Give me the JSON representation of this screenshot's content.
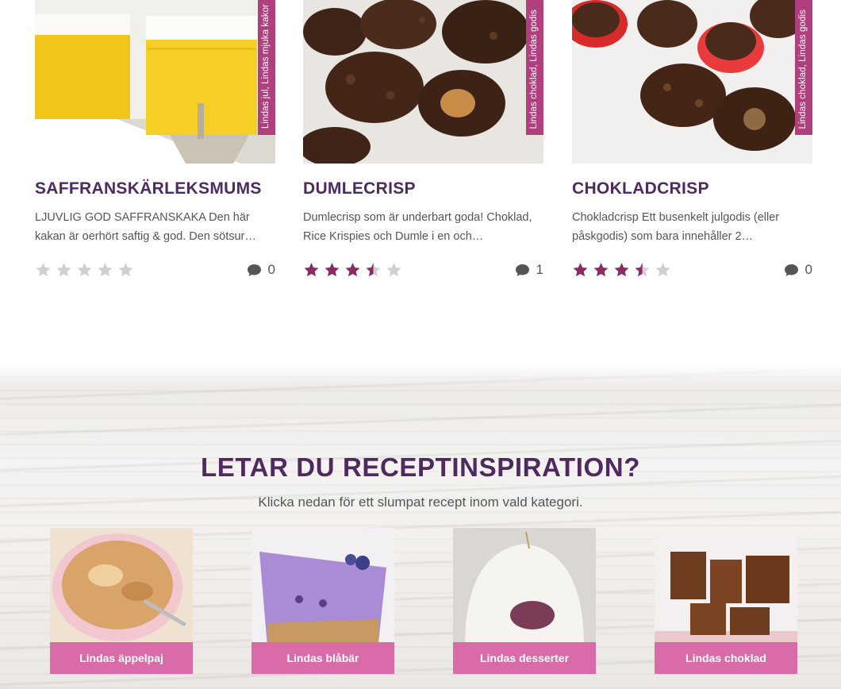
{
  "recipes": [
    {
      "title": "SAFFRANSKÄRLEKSMUMS",
      "categories": "Lindas jul, Lindas mjuka kakor",
      "excerpt": "LJUVLIG GOD SAFFRANSKAKA Den här kakan är oerhört saftig & god. Den sötsur…",
      "rating": 0,
      "comments": "0"
    },
    {
      "title": "DUMLECRISP",
      "categories": "Lindas choklad, Lindas godis",
      "excerpt": "Dumlecrisp som är underbart goda! Choklad, Rice Krispies och Dumle i en och…",
      "rating": 3.5,
      "comments": "1"
    },
    {
      "title": "CHOKLADCRISP",
      "categories": "Lindas choklad, Lindas godis",
      "excerpt": "Chokladcrisp Ett busenkelt julgodis (eller påskgodis) som bara innehåller 2…",
      "rating": 3.5,
      "comments": "0"
    }
  ],
  "inspiration": {
    "title": "LETAR DU RECEPTINSPIRATION?",
    "subtitle": "Klicka nedan för ett slumpat recept inom vald kategori.",
    "categories": [
      {
        "label": "Lindas äppelpaj"
      },
      {
        "label": "Lindas blåbär"
      },
      {
        "label": "Lindas desserter"
      },
      {
        "label": "Lindas choklad"
      }
    ]
  },
  "colors": {
    "brand_purple": "#4e2a60",
    "ribbon": "#b03f7d",
    "category_button": "#d86ba8",
    "star_filled": "#8b2a63",
    "star_empty": "#d0d0d0"
  },
  "icons": {
    "rating": "star-icon",
    "comments": "comment-bubble-icon"
  }
}
